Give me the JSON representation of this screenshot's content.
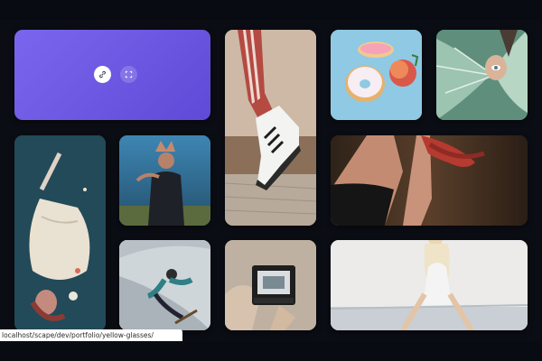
{
  "gallery": {
    "tiles": [
      {
        "id": "hover",
        "name": "gallery-tile-hovered",
        "alt": "",
        "bg": "#6d58e4"
      },
      {
        "id": "sneaker",
        "name": "gallery-tile-sneaker",
        "bg": "#c9b8a6"
      },
      {
        "id": "donuts",
        "name": "gallery-tile-donuts",
        "bg": "#8ec8e4"
      },
      {
        "id": "leaf",
        "name": "gallery-tile-leaf",
        "bg": "#6a9c86"
      },
      {
        "id": "water",
        "name": "gallery-tile-water-dress",
        "bg": "#274f60"
      },
      {
        "id": "crown",
        "name": "gallery-tile-crown-woman",
        "bg": "#3f7fa6"
      },
      {
        "id": "redhair",
        "name": "gallery-tile-red-hair",
        "bg": "#3b2a20"
      },
      {
        "id": "skate",
        "name": "gallery-tile-skateboarder",
        "bg": "#c4cdd3"
      },
      {
        "id": "camera",
        "name": "gallery-tile-camera",
        "bg": "#b6a898"
      },
      {
        "id": "beach",
        "name": "gallery-tile-beach",
        "bg": "#e6e4e2"
      }
    ],
    "hover_actions": {
      "link_icon": "link-icon",
      "expand_icon": "expand-icon"
    }
  },
  "status_bar": {
    "url": "localhost/scape/dev/portfolio/yellow-glasses/"
  },
  "colors": {
    "background": "#0b0d14",
    "accent": "#6d58e4",
    "statusbar": "#ffffff"
  }
}
